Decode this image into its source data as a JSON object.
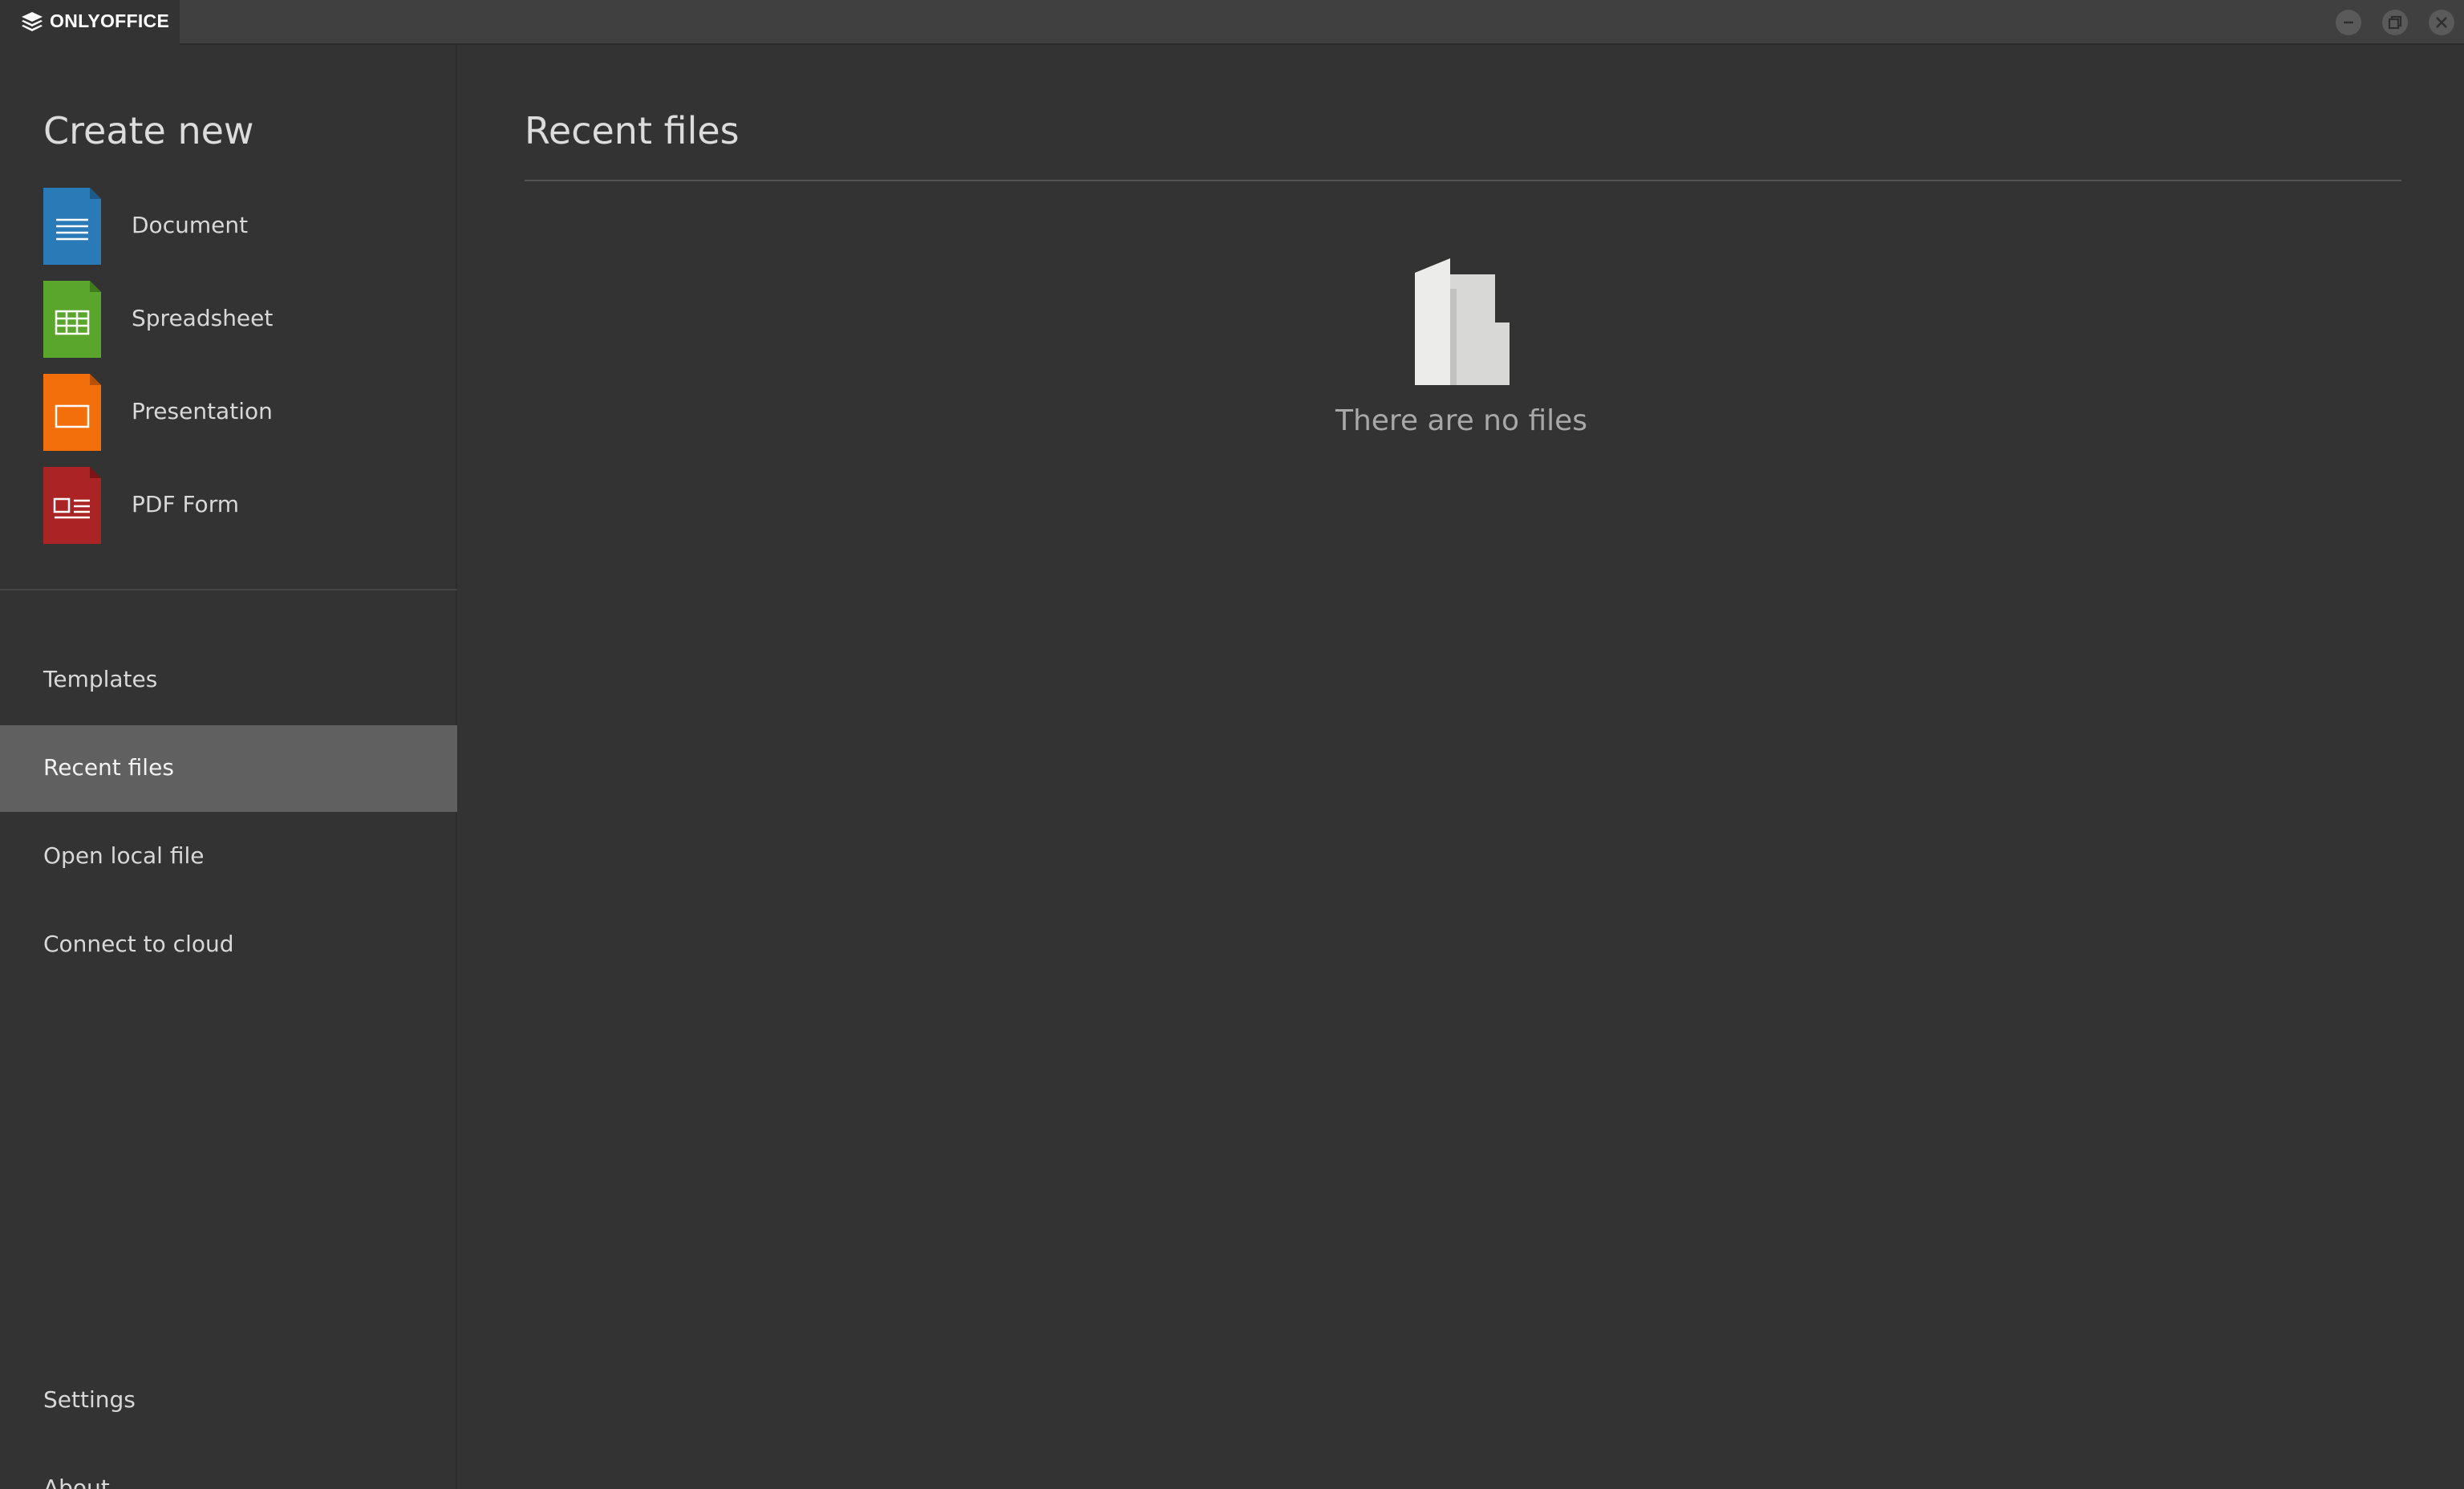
{
  "app": {
    "name": "ONLYOFFICE",
    "logo_icon": "onlyoffice-layers-icon"
  },
  "window_controls": {
    "minimize_icon": "minimize-icon",
    "restore_icon": "restore-icon",
    "close_icon": "close-icon"
  },
  "sidebar": {
    "create_title": "Create new",
    "create_items": [
      {
        "label": "Document",
        "icon": "document-icon",
        "color": "#2a7ab7"
      },
      {
        "label": "Spreadsheet",
        "icon": "spreadsheet-icon",
        "color": "#5aa52c"
      },
      {
        "label": "Presentation",
        "icon": "presentation-icon",
        "color": "#f26f0b"
      },
      {
        "label": "PDF Form",
        "icon": "pdf-form-icon",
        "color": "#aa2325"
      }
    ],
    "nav_items": [
      {
        "label": "Templates",
        "active": false
      },
      {
        "label": "Recent files",
        "active": true
      },
      {
        "label": "Open local file",
        "active": false
      },
      {
        "label": "Connect to cloud",
        "active": false
      }
    ],
    "bottom_items": [
      {
        "label": "Settings"
      },
      {
        "label": "About"
      }
    ]
  },
  "main": {
    "title": "Recent files",
    "empty_icon": "empty-folder-icon",
    "empty_text": "There are no files"
  },
  "colors": {
    "background": "#333333",
    "titlebar": "#404040",
    "active_nav": "#606060"
  }
}
